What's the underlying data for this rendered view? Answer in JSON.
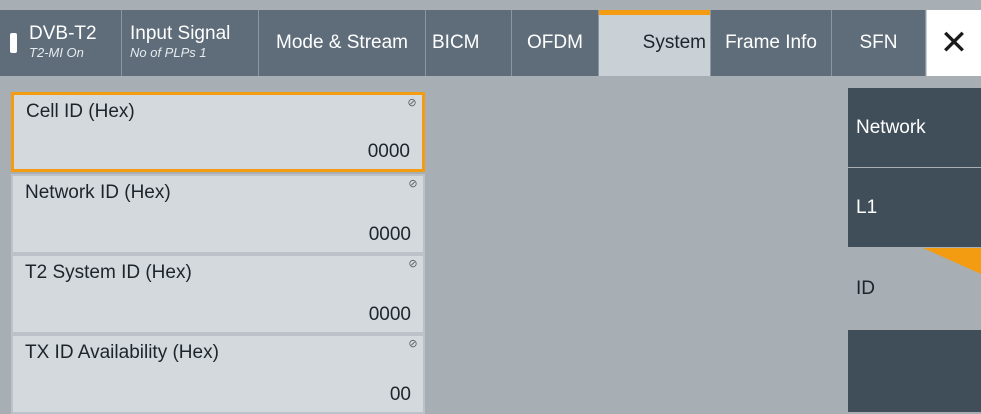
{
  "tabs": [
    {
      "title": "DVB-T2",
      "subtitle": "T2-MI On",
      "status": true
    },
    {
      "title": "Input Signal",
      "subtitle": "No of PLPs 1"
    },
    {
      "title": "Mode & Stream"
    },
    {
      "title": "BICM"
    },
    {
      "title": "OFDM"
    },
    {
      "title": "System",
      "active": true
    },
    {
      "title": "Frame Info"
    },
    {
      "title": "SFN"
    }
  ],
  "close_label": "✕",
  "fields": [
    {
      "label": "Cell ID (Hex)",
      "value": "0000"
    },
    {
      "label": "Network ID (Hex)",
      "value": "0000"
    },
    {
      "label": "T2 System ID (Hex)",
      "value": "0000"
    },
    {
      "label": "TX ID Availability (Hex)",
      "value": "00"
    }
  ],
  "side_menu": [
    {
      "label": "Network"
    },
    {
      "label": "L1"
    },
    {
      "label": "ID",
      "active": true
    },
    {
      "label": ""
    }
  ],
  "colors": {
    "accent": "#f39c12",
    "tab_bg": "#5e6d79",
    "side_bg": "#3f4e59",
    "panel_bg": "#a7aeb4"
  }
}
